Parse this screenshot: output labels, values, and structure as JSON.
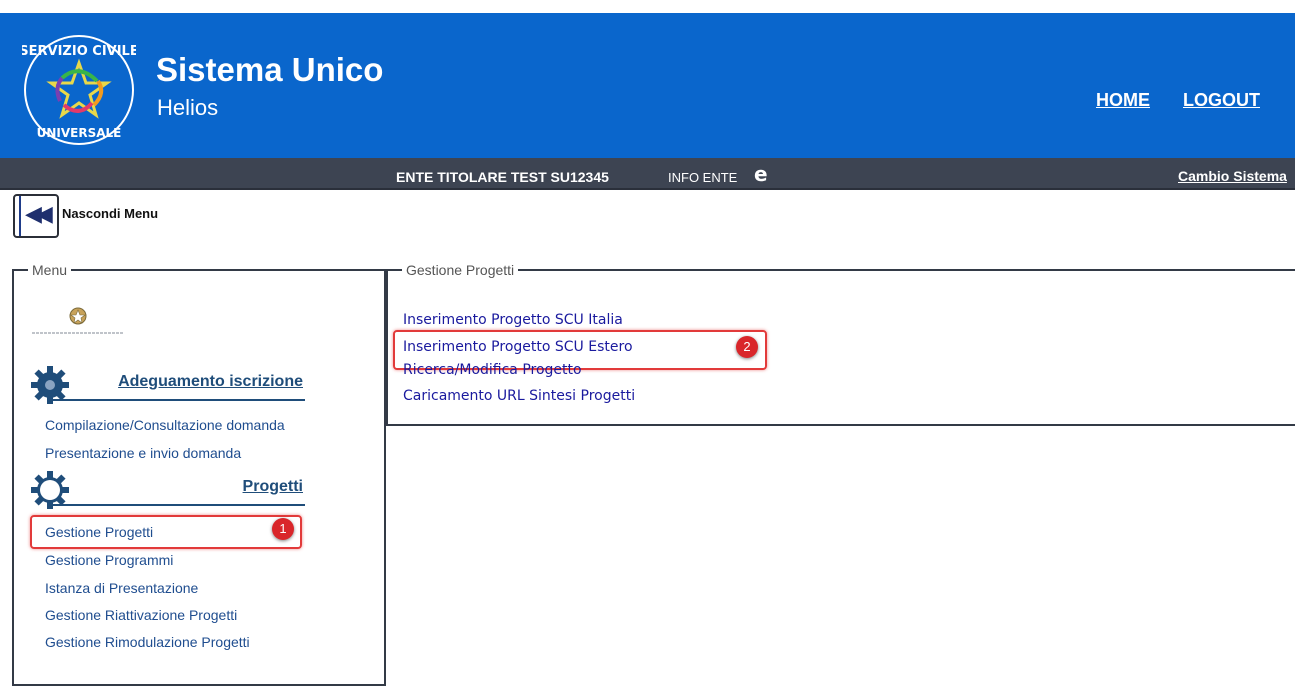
{
  "header": {
    "title": "Sistema Unico",
    "subtitle": "Helios",
    "logo_text": "SERVIZIO CIVILE UNIVERSALE",
    "nav": [
      {
        "label": "HOME"
      },
      {
        "label": "LOGOUT"
      }
    ]
  },
  "subbar": {
    "ente": "ENTE TITOLARE TEST  SU12345",
    "info": "INFO ENTE",
    "info_icon": "e-icon",
    "cambio": "Cambio Sistema"
  },
  "toggle": {
    "label": "Nascondi Menu",
    "icon": "rewind-icon"
  },
  "menu": {
    "legend": "Menu",
    "emblem": "italian-republic-emblem",
    "sections": [
      {
        "title": "Adeguamento iscrizione",
        "icon": "gear-icon",
        "items": [
          "Compilazione/Consultazione domanda",
          "Presentazione e invio domanda"
        ]
      },
      {
        "title": "Progetti",
        "icon": "gear-icon",
        "items": [
          "Gestione Progetti",
          "Gestione Programmi",
          "Istanza di Presentazione",
          "Gestione Riattivazione Progetti",
          "Gestione Rimodulazione Progetti"
        ]
      }
    ]
  },
  "gestione": {
    "legend": "Gestione Progetti",
    "links": [
      "Inserimento Progetto SCU Italia",
      "Inserimento Progetto SCU Estero",
      "Ricerca/Modifica Progetto",
      "Caricamento URL Sintesi Progetti"
    ]
  },
  "annotations": {
    "badge1": "1",
    "badge2": "2"
  },
  "colors": {
    "header": "#0a66cc",
    "subbar": "#3d4452",
    "link": "#1f4d8f",
    "highlight": "#e23a3a"
  }
}
